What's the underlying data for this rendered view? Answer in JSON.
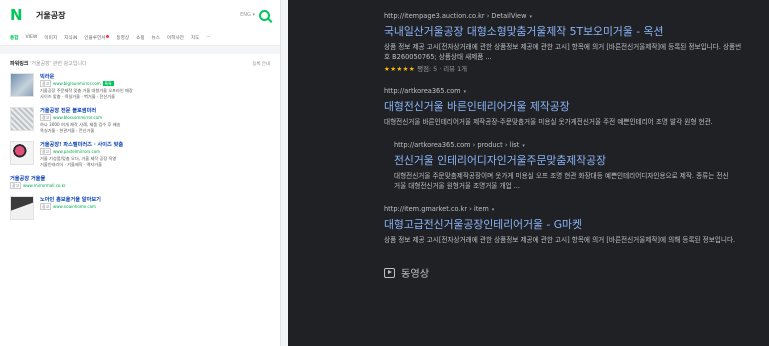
{
  "naver": {
    "logo": "N",
    "query": "거울공장",
    "keyboard": "ENG ▾",
    "tabs": [
      "통합",
      "VIEW",
      "이미지",
      "지식iN",
      "인플루언서",
      "동영상",
      "쇼핑",
      "뉴스",
      "어학사전",
      "지도",
      "···"
    ],
    "panel_title": "파워링크",
    "panel_title_sub": " '거울공장' 관련 광고입니다",
    "panel_right": "등록 안내",
    "ads": [
      {
        "title": "빅라운",
        "url": "www.bigrounmirror.com",
        "desc1": "거울공장 주문제작 맞춤 거울 대형거울 오프라인 매장",
        "desc2": "사이즈 맞춤 · 욕실거울 · 벽거울 · 전신거울"
      },
      {
        "title": "거울공장 전문 블로썸미러",
        "url": "www.blossommirror.com",
        "desc1": "하나 3000 여개 제작 사례, 제품 검수 후 배송",
        "desc2": "욕실거울 · 현관거울 · 전신거울"
      },
      {
        "title": "거울공장! 파스텔미러즈 · 사이즈 맞춤",
        "url": "www.pastelmirrors.com",
        "desc1": "거울 기성품/맞춤 오더, 거울 제작 공장 직영",
        "desc2": "거울인테리어 · 거울제작 · 액자거울"
      },
      {
        "title": "거울공장 거울몰",
        "url": "www.mirrormall.co.kr",
        "desc1": "",
        "desc2": ""
      },
      {
        "title": "노아인 홈보울거울 알아보기",
        "url": "www.noainhome.com",
        "desc1": "",
        "desc2": ""
      }
    ],
    "ad_badge": "광고",
    "ad_tag": "톡톡"
  },
  "results": [
    {
      "url": "http://itempage3.auction.co.kr › DetailView",
      "title": "국내일산거울공장 대형소형맞춤거울제작 5T보오미거울 - 옥션",
      "snippet": "상품 정보 제공 고시[전자상거래에 관한 상품정보 제공에 관한 고시] 항목에 의거 [바른전신거울제작]에 등록된 정보입니다. 상품번호 B260050765; 상품상태 새제품 ...",
      "stars": "★★★★★",
      "rating": " 평점: 5 · 리뷰 1개"
    },
    {
      "url": "http://artkorea365.com",
      "title": "대형전신거울 바른인테리어거울 제작공장",
      "snippet": "대형전신거울 바른인테리어거울 제작공장-주문맞춤거울 미용실 옷가게전신거울 주전 예쁜인테리어 조명 발각 원형 현관.",
      "stars": "",
      "rating": ""
    },
    {
      "url": "http://artkorea365.com › product › list",
      "title": "전신거울 인테리어디자인거울주문맞춤제작공장",
      "snippet": "대형전신거울 주문맞춤제작공장이며 옷가게 미용실 오프 조명 현관 화장대등 예쁜인테리어디자인용으로 제작. 종류는 전신거울 대형전신거울 원형거울 조명거울 개업 ...",
      "stars": "",
      "rating": ""
    },
    {
      "url": "http://item.gmarket.co.kr › item",
      "title": "대형고급전신거울공장인테리어거울 - G마켓",
      "snippet": "상품 정보 제공 고시[전자상거래에 관한 상품정보 제공에 관한 고시] 항목에 의거 [바른전신거울제작]에 의해 등록된 정보입니다.",
      "stars": "",
      "rating": ""
    }
  ],
  "video_label": "동영상",
  "colors": {
    "google_bg": "#202124",
    "link": "#8ab4f8",
    "naver_green": "#03c75a"
  }
}
